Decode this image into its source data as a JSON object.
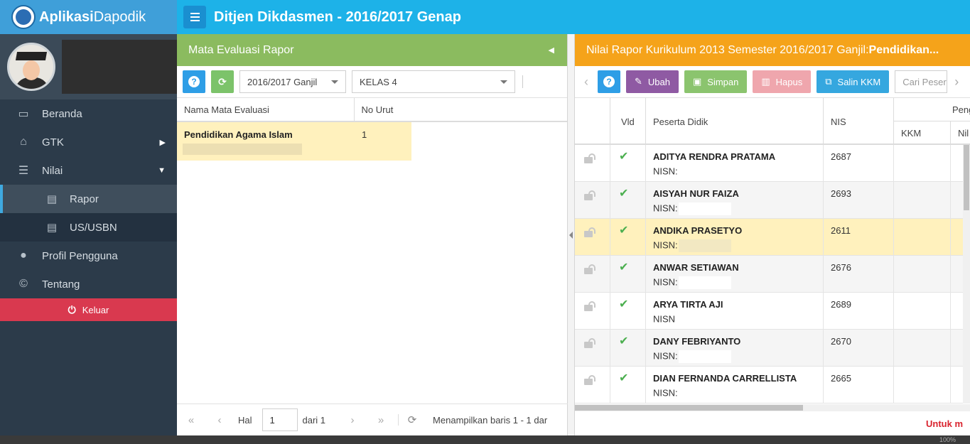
{
  "app": {
    "brand_bold": "Aplikasi",
    "brand_light": "Dapodik",
    "top_title": "Ditjen Dikdasmen - 2016/2017 Genap"
  },
  "sidebar": {
    "items": [
      {
        "label": "Beranda",
        "icon": "monitor-icon"
      },
      {
        "label": "GTK",
        "icon": "graduation-cap-icon"
      },
      {
        "label": "Nilai",
        "icon": "list-icon"
      },
      {
        "label": "Profil Pengguna",
        "icon": "user-icon"
      },
      {
        "label": "Tentang",
        "icon": "copyright-icon"
      }
    ],
    "subitems": [
      {
        "label": "Rapor",
        "icon": "document-icon"
      },
      {
        "label": "US/USBN",
        "icon": "document-icon"
      }
    ],
    "logout_label": "Keluar"
  },
  "left_panel": {
    "title": "Mata Evaluasi Rapor",
    "semester_select": "2016/2017 Ganjil",
    "class_select": "KELAS 4",
    "columns": [
      "Nama Mata Evaluasi",
      "No Urut"
    ],
    "rows": [
      {
        "nama": "Pendidikan Agama Islam",
        "no_urut": "1"
      }
    ],
    "pager": {
      "hal_label": "Hal",
      "page": "1",
      "dari_label": "dari 1",
      "info": "Menampilkan baris 1 - 1 dar"
    }
  },
  "right_panel": {
    "title_prefix": "Nilai Rapor Kurikulum 2013 Semester 2016/2017 Ganjil: ",
    "title_bold": "Pendidikan...",
    "buttons": {
      "ubah": "Ubah",
      "simpan": "Simpan",
      "hapus": "Hapus",
      "salin": "Salin KKM"
    },
    "search_placeholder": "Cari Peser",
    "columns": {
      "vld": "Vld",
      "peserta": "Peserta Didik",
      "nis": "NIS",
      "group": "Peng",
      "kkm": "KKM",
      "nilai": "Nil"
    },
    "rows": [
      {
        "name": "ADITYA RENDRA PRATAMA",
        "nisn_label": "NISN:",
        "nis": "2687"
      },
      {
        "name": "AISYAH NUR FAIZA",
        "nisn_label": "NISN:",
        "nis": "2693"
      },
      {
        "name": "ANDIKA PRASETYO",
        "nisn_label": "NISN:",
        "nis": "2611"
      },
      {
        "name": "ANWAR SETIAWAN",
        "nisn_label": "NISN:",
        "nis": "2676"
      },
      {
        "name": "ARYA TIRTA AJI",
        "nisn_label": "NISN",
        "nis": "2689"
      },
      {
        "name": "DANY FEBRIYANTO",
        "nisn_label": "NISN:",
        "nis": "2670"
      },
      {
        "name": "DIAN FERNANDA CARRELLISTA",
        "nisn_label": "NISN:",
        "nis": "2665"
      }
    ],
    "footer_text": "Untuk m"
  },
  "statusbar": {
    "zoom": "100%"
  }
}
